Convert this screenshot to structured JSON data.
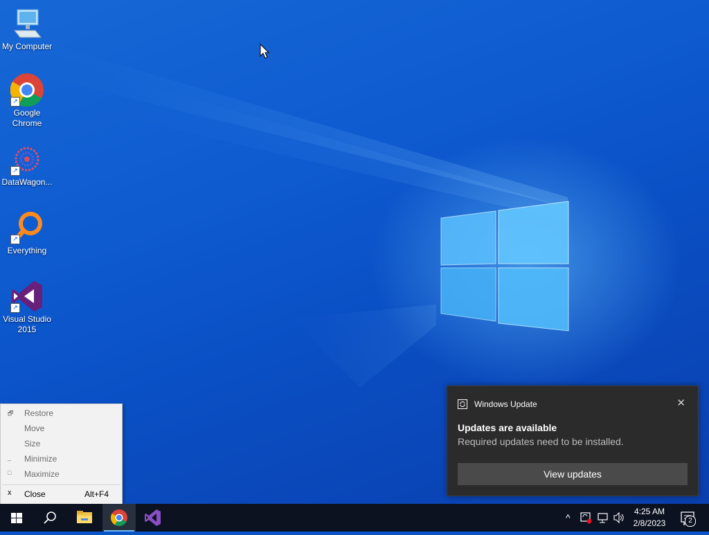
{
  "desktop": {
    "icons": [
      {
        "label_line1": "My Computer",
        "label_line2": "",
        "icon": "computer-icon"
      },
      {
        "label_line1": "Google",
        "label_line2": "Chrome",
        "icon": "chrome-icon"
      },
      {
        "label_line1": "DataWagon...",
        "label_line2": "",
        "icon": "datawagon-icon"
      },
      {
        "label_line1": "Everything",
        "label_line2": "",
        "icon": "everything-search-icon"
      },
      {
        "label_line1": "Visual Studio",
        "label_line2": "2015",
        "icon": "visual-studio-icon"
      }
    ]
  },
  "context_menu": {
    "items": [
      {
        "glyph": "🗗",
        "label": "Restore",
        "shortcut": "",
        "enabled": true
      },
      {
        "glyph": "",
        "label": "Move",
        "shortcut": "",
        "enabled": false
      },
      {
        "glyph": "",
        "label": "Size",
        "shortcut": "",
        "enabled": false
      },
      {
        "glyph": "_",
        "label": "Minimize",
        "shortcut": "",
        "enabled": false
      },
      {
        "glyph": "□",
        "label": "Maximize",
        "shortcut": "",
        "enabled": false
      },
      {
        "glyph": "x",
        "label": "Close",
        "shortcut": "Alt+F4",
        "enabled": true
      }
    ]
  },
  "notification": {
    "app_name": "Windows Update",
    "close_glyph": "✕",
    "title": "Updates are available",
    "body": "Required updates need to be installed.",
    "button_label": "View updates"
  },
  "taskbar": {
    "buttons": [
      "start-button",
      "search-button",
      "file-explorer-button",
      "chrome-button",
      "visual-studio-button"
    ],
    "active": "chrome-button",
    "tray": {
      "chevron_glyph": "^",
      "clock_time": "4:25 AM",
      "clock_date": "2/8/2023",
      "notification_count": "2"
    }
  },
  "colors": {
    "accent": "#76b9ed",
    "taskbar_bg": "#0c1220",
    "toast_bg": "#2b2b2b",
    "menu_bg": "#f2f2f2"
  }
}
